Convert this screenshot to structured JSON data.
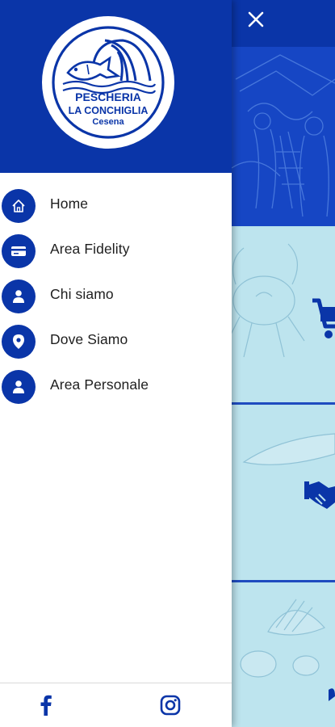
{
  "brand": {
    "line1": "PESCHERIA",
    "line2": "LA CONCHIGLIA",
    "line3": "Cesena"
  },
  "colors": {
    "primary": "#0a35a8",
    "background_light": "#b9e3ee",
    "text": "#1e1e1e"
  },
  "menu": {
    "items": [
      {
        "label": "Home",
        "icon": "home-icon"
      },
      {
        "label": "Area Fidelity",
        "icon": "card-icon"
      },
      {
        "label": "Chi siamo",
        "icon": "person-icon"
      },
      {
        "label": "Dove Siamo",
        "icon": "location-pin-icon"
      },
      {
        "label": "Area Personale",
        "icon": "person-icon"
      }
    ]
  },
  "footer": {
    "social": [
      {
        "name": "facebook",
        "icon": "facebook-icon"
      },
      {
        "name": "instagram",
        "icon": "instagram-icon"
      }
    ]
  },
  "background_cards": [
    {
      "icon": "shopping-cart-icon"
    },
    {
      "icon": "handshake-icon"
    },
    {
      "icon": "shell-illustration"
    }
  ]
}
